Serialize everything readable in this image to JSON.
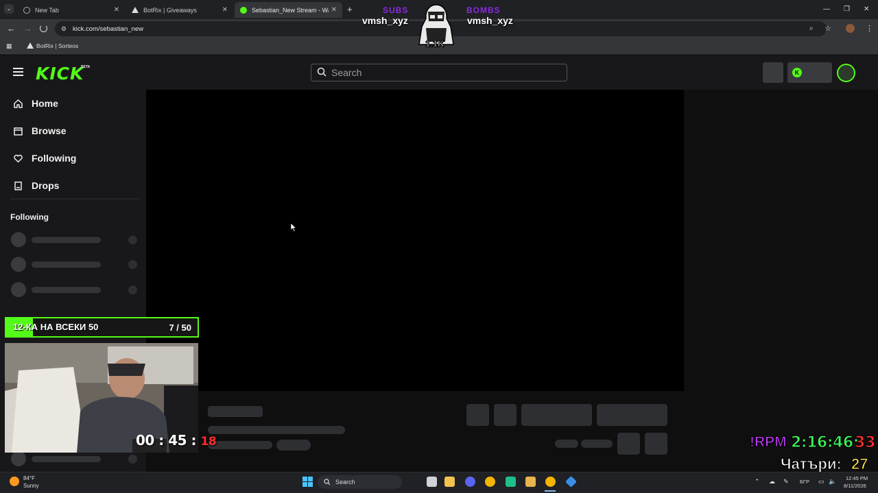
{
  "browser": {
    "tabs": [
      {
        "title": "New Tab",
        "active": false
      },
      {
        "title": "BotRix | Giveaways",
        "active": false
      },
      {
        "title": "Sebastian_New Stream - Watch",
        "active": true
      }
    ],
    "new_tab_icon": "plus-icon",
    "url": "kick.com/sebastian_new",
    "bookmark": "BotRix | Sorteos"
  },
  "kick": {
    "logo": "KICK",
    "logo_badge": "BETA",
    "search_placeholder": "Search",
    "accent_color": "#53fc18",
    "nav": [
      {
        "label": "Home",
        "icon": "home-icon"
      },
      {
        "label": "Browse",
        "icon": "browse-icon"
      },
      {
        "label": "Following",
        "icon": "heart-icon"
      },
      {
        "label": "Drops",
        "icon": "drops-icon"
      }
    ],
    "following_heading": "Following"
  },
  "overlay": {
    "subs_label": "SUBS",
    "subs_name": "vmsh_xyz",
    "bombs_label": "BOMBS",
    "bombs_name": "vmsh_xyz",
    "mascot_count": "1.1K",
    "goal_text": "12-КА НА ВСЕКИ 50",
    "goal_count": "7 / 50",
    "goal_progress": 0.14,
    "cam_timer_hm": "00 : 45 :",
    "cam_timer_s": "18",
    "rpm_label": "!RPM",
    "rpm_time": "2:16:46:",
    "rpm_secs": "33",
    "chatri_label": "Чатъри:",
    "chatri_value": "27"
  },
  "taskbar": {
    "weather_temp": "84°F",
    "weather_desc": "Sunny",
    "search_label": "Search",
    "language": "БГР",
    "time": "12:45 PM",
    "date": "8/11/2026"
  }
}
